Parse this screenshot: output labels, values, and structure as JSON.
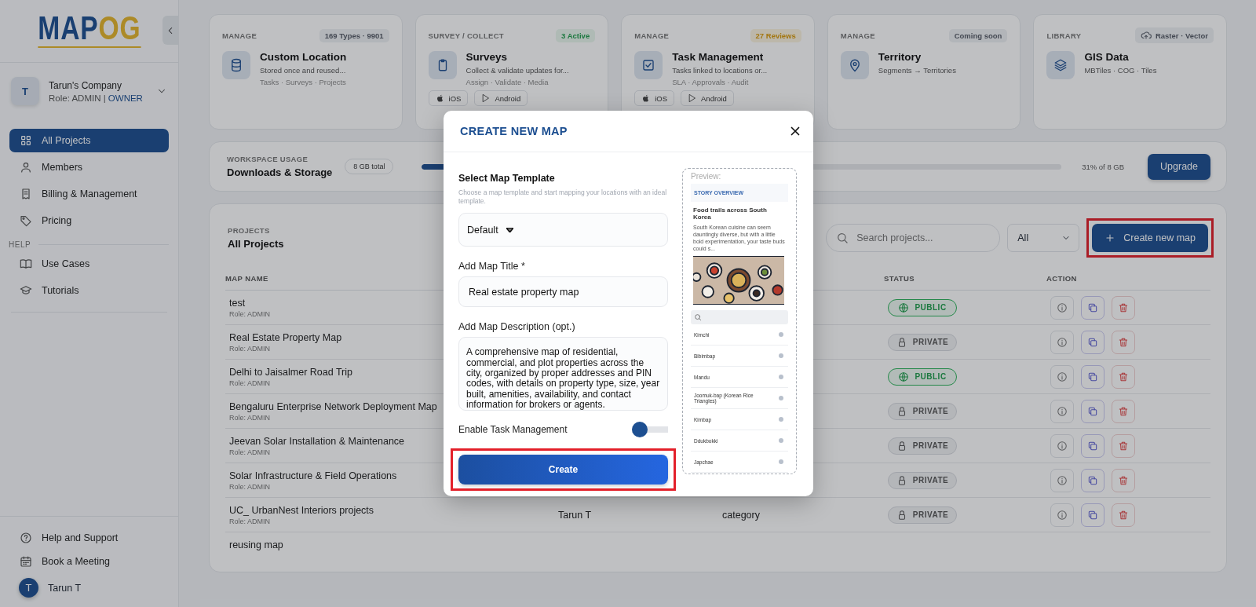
{
  "sidebar": {
    "logo": {
      "part_1": "MAP",
      "part_2": "OG"
    },
    "company": {
      "initial": "T",
      "name": "Tarun's Company",
      "role": "Role: ADMIN |",
      "role_highlight": "OWNER"
    },
    "nav": [
      {
        "label": "All Projects",
        "selected": true
      },
      {
        "label": "Members",
        "selected": false
      },
      {
        "label": "Billing & Management",
        "selected": false
      },
      {
        "label": "Pricing",
        "selected": false
      }
    ],
    "help_heading": "HELP",
    "help_items": [
      {
        "label": "Use Cases"
      },
      {
        "label": "Tutorials"
      }
    ],
    "footer_items": [
      {
        "label": "Help and Support"
      },
      {
        "label": "Book a Meeting"
      }
    ],
    "user": {
      "initial": "T",
      "name": "Tarun T"
    }
  },
  "cards": [
    {
      "category": "MANAGE",
      "badge": {
        "text": "169 Types · 9901",
        "kind": "neutral"
      },
      "title": "Custom Location",
      "subtitle": "Stored once and reused...",
      "meta": "Tasks · Surveys · Projects"
    },
    {
      "category": "SURVEY / COLLECT",
      "badge": {
        "text": "3 Active",
        "kind": "success"
      },
      "title": "Surveys",
      "subtitle": "Collect & validate updates for...",
      "meta": "Assign · Validate · Media",
      "platforms": [
        "iOS",
        "Android"
      ]
    },
    {
      "category": "MANAGE",
      "badge": {
        "text": "27 Reviews",
        "kind": "warning"
      },
      "title": "Task Management",
      "subtitle": "Tasks linked to locations or...",
      "meta": "SLA · Approvals · Audit",
      "platforms": [
        "iOS",
        "Android"
      ]
    },
    {
      "category": "MANAGE",
      "badge": {
        "text": "Coming soon",
        "kind": "neutral"
      },
      "title": "Territory",
      "subtitle": "Segments → Territories"
    },
    {
      "category": "LIBRARY",
      "badge": {
        "text": "Raster · Vector",
        "kind": "neutral"
      },
      "title": "GIS Data",
      "subtitle": "MBTiles · COG · Tiles"
    }
  ],
  "usage": {
    "label": "WORKSPACE USAGE",
    "title": "Downloads & Storage",
    "total": "8 GB total",
    "level": 0.31,
    "reading": "31% of 8 GB",
    "button": "Upgrade"
  },
  "projects": {
    "label": "PROJECTS",
    "title": "All Projects",
    "search": {
      "placeholder": "Search projects..."
    },
    "filter": "All",
    "create_button": {
      "label": "Create new map",
      "highlighted": true
    },
    "columns": [
      "MAP NAME",
      "STATUS",
      "ACTION"
    ],
    "rows": [
      {
        "name": "test",
        "role": "Role: ADMIN",
        "status": {
          "kind": "public",
          "text": "PUBLIC"
        }
      },
      {
        "name": "Real Estate Property Map",
        "role": "Role: ADMIN",
        "status": {
          "kind": "private",
          "text": "PRIVATE"
        }
      },
      {
        "name": "Delhi to Jaisalmer Road Trip",
        "role": "Role: ADMIN",
        "status": {
          "kind": "public",
          "text": "PUBLIC"
        }
      },
      {
        "name": "Bengaluru Enterprise Network Deployment Map",
        "role": "Role: ADMIN",
        "status": {
          "kind": "private",
          "text": "PRIVATE"
        }
      },
      {
        "name": "Jeevan Solar Installation & Maintenance",
        "role": "Role: ADMIN",
        "status": {
          "kind": "private",
          "text": "PRIVATE"
        }
      },
      {
        "name": "Solar Infrastructure & Field Operations",
        "role": "Role: ADMIN",
        "status": {
          "kind": "private",
          "text": "PRIVATE"
        }
      },
      {
        "name": "UC_ UrbanNest Interiors projects",
        "role": "Role: ADMIN",
        "owner": "Tarun T",
        "category": "category",
        "status": {
          "kind": "private",
          "text": "PRIVATE"
        }
      },
      {
        "name": "reusing map"
      }
    ]
  },
  "modal": {
    "title": "CREATE NEW MAP",
    "template": {
      "label": "Select Map Template",
      "hint": "Choose a map template and start mapping your locations with an ideal template.",
      "value": "Default"
    },
    "map_title": {
      "label": "Add Map Title *",
      "value": "Real estate property map"
    },
    "description": {
      "label": "Add Map Description (opt.)",
      "value": "A comprehensive map of residential, commercial, and plot properties across the city, organized by proper addresses and PIN codes, with details on property type, size, year built, amenities, availability, and contact information for brokers or agents."
    },
    "task_toggle": {
      "label": "Enable Task Management",
      "on": false
    },
    "create_button": {
      "label": "Create",
      "highlighted": true
    },
    "preview": {
      "label": "Preview:",
      "heading": "STORY OVERVIEW",
      "story_title": "Food trails across South Korea",
      "story_text": "South Korean cuisine can seem dauntingly diverse, but with a little bold experimentation, your taste buds could s...",
      "items": [
        "Kimchi",
        "Bibimbap",
        "Mandu",
        "Joomuk-bap (Korean Rice Triangles)",
        "Kimbap",
        "Ddukbokki",
        "Japchae"
      ]
    }
  }
}
